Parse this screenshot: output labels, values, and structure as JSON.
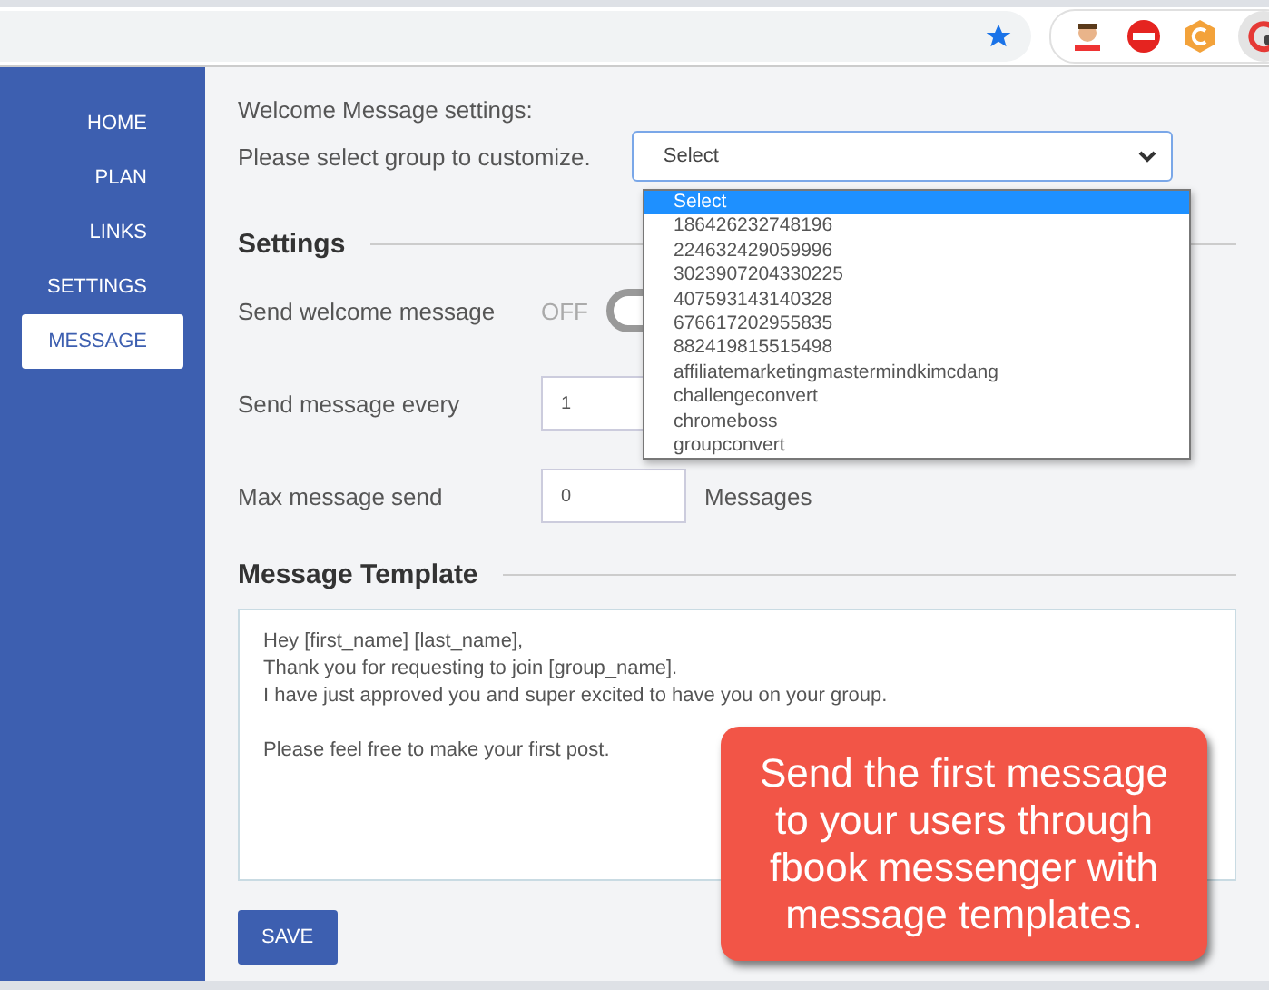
{
  "sidebar": {
    "items": [
      {
        "label": "HOME",
        "selected": false
      },
      {
        "label": "PLAN",
        "selected": false
      },
      {
        "label": "LINKS",
        "selected": false
      },
      {
        "label": "SETTINGS",
        "selected": false
      },
      {
        "label": "MESSAGE",
        "selected": true
      }
    ]
  },
  "header": {
    "title": "Welcome Message settings:",
    "group_label": "Please select group to customize.",
    "group_select": {
      "value": "Select",
      "expanded": true,
      "options": [
        {
          "label": "Select",
          "selected": true
        },
        {
          "label": "186426232748196",
          "selected": false
        },
        {
          "label": "224632429059996",
          "selected": false
        },
        {
          "label": "3023907204330225",
          "selected": false
        },
        {
          "label": "407593143140328",
          "selected": false
        },
        {
          "label": "676617202955835",
          "selected": false
        },
        {
          "label": "882419815515498",
          "selected": false
        },
        {
          "label": "affiliatemarketingmastermindkimcdang",
          "selected": false
        },
        {
          "label": "challengeconvert",
          "selected": false
        },
        {
          "label": "chromeboss",
          "selected": false
        },
        {
          "label": "groupconvert",
          "selected": false
        }
      ]
    }
  },
  "settings": {
    "title": "Settings",
    "welcome": {
      "label": "Send welcome message",
      "state_text": "OFF",
      "on": false
    },
    "every": {
      "label": "Send message every",
      "value": "1"
    },
    "max": {
      "label": "Max message send",
      "value": "0",
      "unit": "Messages"
    }
  },
  "template": {
    "title": "Message Template",
    "text": "Hey [first_name] [last_name],\nThank you for requesting to join [group_name].\nI have just approved you and super excited to have you on your group.\n\nPlease feel free to make your first post."
  },
  "save_button": "SAVE",
  "callout": "Send the first message to your users through fbook messenger with message templates."
}
